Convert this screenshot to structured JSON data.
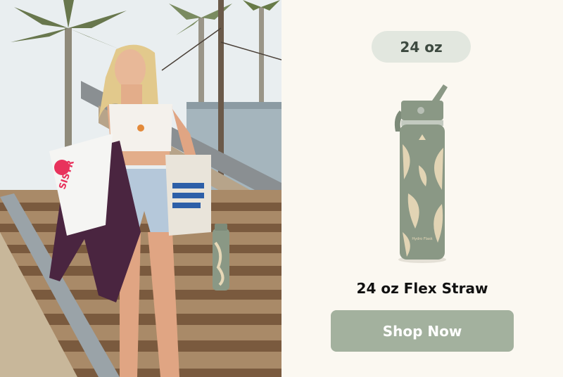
{
  "product": {
    "size_label": "24 oz",
    "name": "24 oz Flex Straw",
    "cta_label": "Shop Now",
    "brand_mark": "Hydro Flask"
  },
  "photo": {
    "board_text": "SISTR"
  },
  "colors": {
    "panel_bg": "#fbf8f1",
    "pill_bg": "#e2e7df",
    "cta_bg": "#a3b19e",
    "bottle_body": "#8a9885",
    "leaf_pattern": "#e7d8b7"
  }
}
